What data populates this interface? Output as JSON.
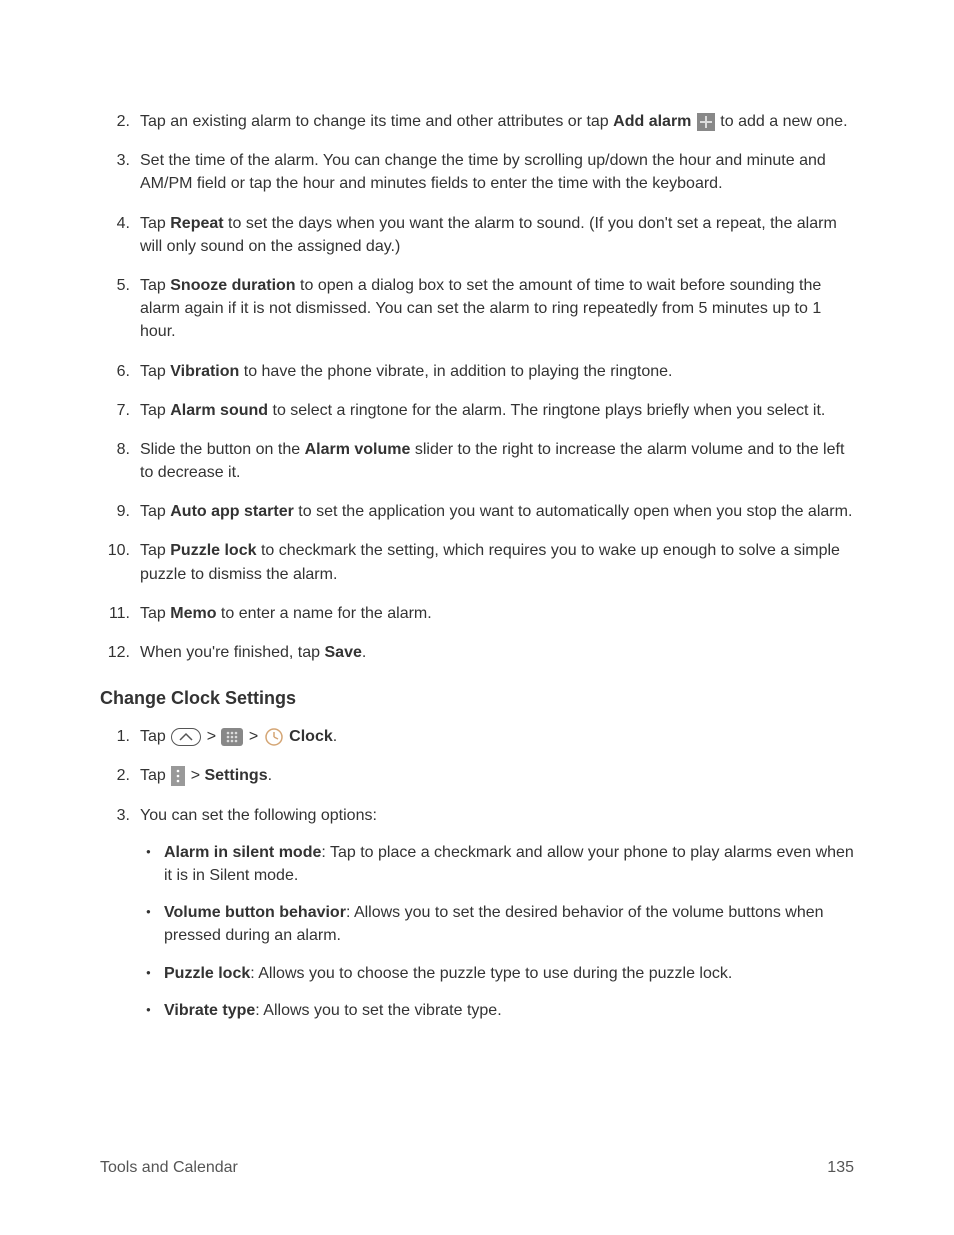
{
  "steps": [
    {
      "num": "2.",
      "pre": "Tap an existing alarm to change its time and other attributes or tap ",
      "bold": "Add alarm",
      "post": " to add a new one.",
      "icon": "plus"
    },
    {
      "num": "3.",
      "text": "Set the time of the alarm. You can change the time by scrolling up/down the hour and minute and AM/PM field or tap the hour and minutes fields to enter the time with the keyboard."
    },
    {
      "num": "4.",
      "pre": "Tap ",
      "bold": "Repeat",
      "post": " to set the days when you want the alarm to sound. (If you don't set a repeat, the alarm will only sound on the assigned day.)"
    },
    {
      "num": "5.",
      "pre": "Tap ",
      "bold": "Snooze duration",
      "post": " to open a dialog box to set the amount of time to wait before sounding the alarm again if it is not dismissed. You can set the alarm to ring repeatedly from 5 minutes up to 1 hour."
    },
    {
      "num": "6.",
      "pre": "Tap ",
      "bold": "Vibration",
      "post": " to have the phone vibrate, in addition to playing the ringtone."
    },
    {
      "num": "7.",
      "pre": "Tap ",
      "bold": "Alarm sound",
      "post": " to select a ringtone for the alarm. The ringtone plays briefly when you select it."
    },
    {
      "num": "8.",
      "pre": "Slide the button on the ",
      "bold": "Alarm volume",
      "post": " slider to the right to increase the alarm volume and to the left to decrease it."
    },
    {
      "num": "9.",
      "pre": "Tap ",
      "bold": "Auto app starter",
      "post": " to set the application you want to automatically open when you stop the alarm."
    },
    {
      "num": "10.",
      "pre": "Tap ",
      "bold": "Puzzle lock",
      "post": " to checkmark the setting, which requires you to wake up enough to solve a simple puzzle to dismiss the alarm."
    },
    {
      "num": "11.",
      "pre": "Tap ",
      "bold": "Memo",
      "post": " to enter a name for the alarm."
    },
    {
      "num": "12.",
      "pre": "When you're finished, tap ",
      "bold": "Save",
      "post": "."
    }
  ],
  "heading": "Change Clock Settings",
  "substeps": {
    "s1": {
      "num": "1.",
      "tap": "Tap ",
      "sep1": " > ",
      "sep2": " > ",
      "clock": " Clock",
      "period": "."
    },
    "s2": {
      "num": "2.",
      "tap": "Tap ",
      "sep": " > ",
      "settings": "Settings",
      "period": "."
    },
    "s3": {
      "num": "3.",
      "text": "You can set the following options:"
    }
  },
  "bullets": [
    {
      "bold": "Alarm in silent mode",
      "text": ": Tap to place a checkmark and allow your phone to play alarms even when it is in Silent mode."
    },
    {
      "bold": "Volume button behavior",
      "text": ": Allows you to set the desired behavior of the volume buttons when pressed during an alarm."
    },
    {
      "bold": "Puzzle lock",
      "text": ": Allows you to choose the puzzle type to use during the puzzle lock."
    },
    {
      "bold": "Vibrate type",
      "text": ": Allows you to set the vibrate type."
    }
  ],
  "footer": {
    "left": "Tools and Calendar",
    "right": "135"
  }
}
